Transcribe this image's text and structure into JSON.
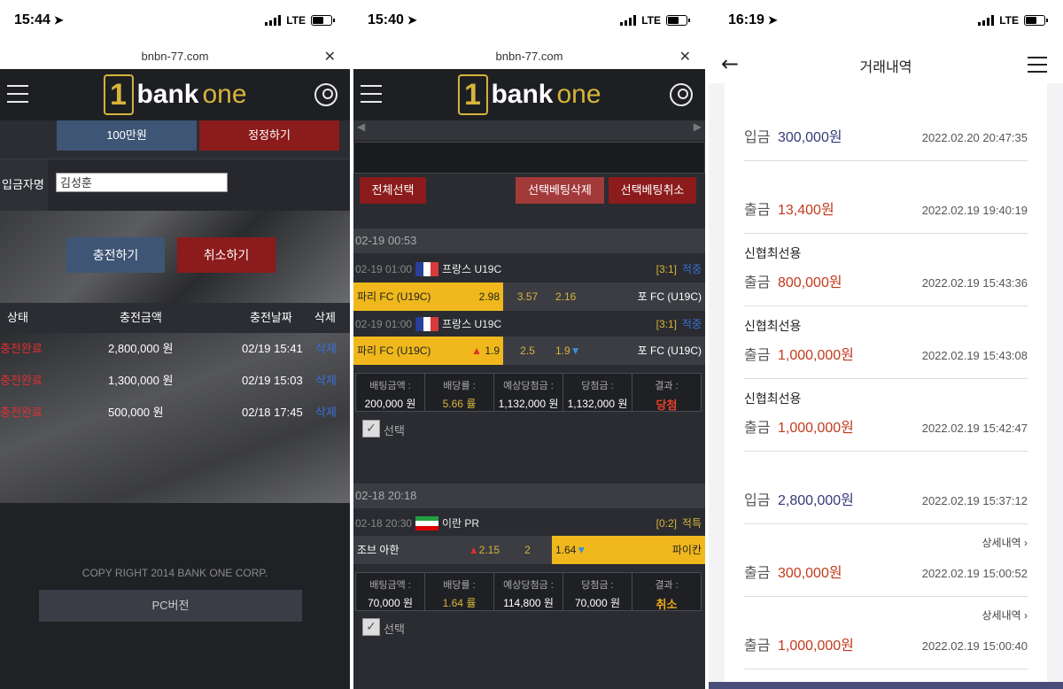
{
  "panel1": {
    "status": {
      "time": "15:44",
      "network": "LTE"
    },
    "url": "bnbn-77.com",
    "logo": {
      "mark": "1",
      "bank": "bank",
      "one": "one"
    },
    "amount_button": "100만원",
    "correct_button": "정정하기",
    "depositor_label": "입금자명",
    "depositor_value": "김성훈",
    "charge_button": "충전하기",
    "cancel_button": "취소하기",
    "table_headers": [
      "상태",
      "충전금액",
      "충전날짜",
      "삭제"
    ],
    "rows": [
      {
        "status": "충전완료",
        "amount": "2,800,000 원",
        "date": "02/19 15:41",
        "delete": "삭제"
      },
      {
        "status": "충전완료",
        "amount": "1,300,000 원",
        "date": "02/19 15:03",
        "delete": "삭제"
      },
      {
        "status": "충전완료",
        "amount": "500,000 원",
        "date": "02/18 17:45",
        "delete": "삭제"
      }
    ],
    "copyright": "COPY RIGHT 2014 BANK ONE CORP.",
    "pc_button": "PC버전"
  },
  "panel2": {
    "status": {
      "time": "15:40",
      "network": "LTE"
    },
    "url": "bnbn-77.com",
    "select_all": "전체선택",
    "delete_selected": "선택베팅삭제",
    "cancel_selected": "선택베팅취소",
    "checkbox_label": "선택",
    "slips": [
      {
        "date": "02-19 00:53",
        "matches": [
          {
            "time": "02-19 01:00",
            "league": "프랑스 U19C",
            "score": "[3:1]",
            "result": "적중",
            "home": "파리 FC (U19C)",
            "home_odds": "2.98",
            "draw": "3.57",
            "away_odds": "2.16",
            "away": "포 FC (U19C)"
          },
          {
            "time": "02-19 01:00",
            "league": "프랑스 U19C",
            "score": "[3:1]",
            "result": "적중",
            "home": "파리 FC (U19C)",
            "home_odds": "1.9",
            "draw": "2.5",
            "away_odds": "1.9",
            "away": "포 FC (U19C)"
          }
        ],
        "summary": {
          "bet_label": "배팅금액 :",
          "bet": "200,000 원",
          "odds_label": "배당률 :",
          "odds": "5.66 률",
          "expected_label": "예상당첨금 :",
          "expected": "1,132,000 원",
          "won_label": "당첨금 :",
          "won": "1,132,000 원",
          "result_label": "결과 :",
          "result": "당첨"
        }
      },
      {
        "date": "02-18 20:18",
        "matches": [
          {
            "time": "02-18 20:30",
            "league": "이란 PR",
            "score": "[0:2]",
            "result": "적특",
            "home": "조브 아한",
            "home_odds": "2.15",
            "draw": "2",
            "away_odds": "1.64",
            "away": "파이칸"
          }
        ],
        "summary": {
          "bet_label": "배팅금액 :",
          "bet": "70,000 원",
          "odds_label": "배당률 :",
          "odds": "1.64 률",
          "expected_label": "예상당첨금 :",
          "expected": "114,800 원",
          "won_label": "당첨금 :",
          "won": "70,000 원",
          "result_label": "결과 :",
          "result": "취소"
        }
      }
    ]
  },
  "panel3": {
    "status": {
      "time": "16:19",
      "network": "LTE"
    },
    "title": "거래내역",
    "transactions": [
      {
        "bank": "",
        "detail": "",
        "type": "입금",
        "amount": "300,000원",
        "date": "2022.02.20 20:47:35",
        "kind": "in"
      },
      {
        "bank": "",
        "detail": "",
        "type": "출금",
        "amount": "13,400원",
        "date": "2022.02.19 19:40:19",
        "kind": "out"
      },
      {
        "bank": "신협최선용",
        "detail": "",
        "type": "출금",
        "amount": "800,000원",
        "date": "2022.02.19 15:43:36",
        "kind": "out"
      },
      {
        "bank": "신협최선용",
        "detail": "",
        "type": "출금",
        "amount": "1,000,000원",
        "date": "2022.02.19 15:43:08",
        "kind": "out"
      },
      {
        "bank": "신협최선용",
        "detail": "",
        "type": "출금",
        "amount": "1,000,000원",
        "date": "2022.02.19 15:42:47",
        "kind": "out"
      },
      {
        "bank": "",
        "detail": "",
        "type": "입금",
        "amount": "2,800,000원",
        "date": "2022.02.19 15:37:12",
        "kind": "in"
      },
      {
        "bank": "",
        "detail": "상세내역  ›",
        "type": "출금",
        "amount": "300,000원",
        "date": "2022.02.19 15:00:52",
        "kind": "out"
      },
      {
        "bank": "",
        "detail": "상세내역  ›",
        "type": "출금",
        "amount": "1,000,000원",
        "date": "2022.02.19 15:00:40",
        "kind": "out"
      }
    ]
  }
}
